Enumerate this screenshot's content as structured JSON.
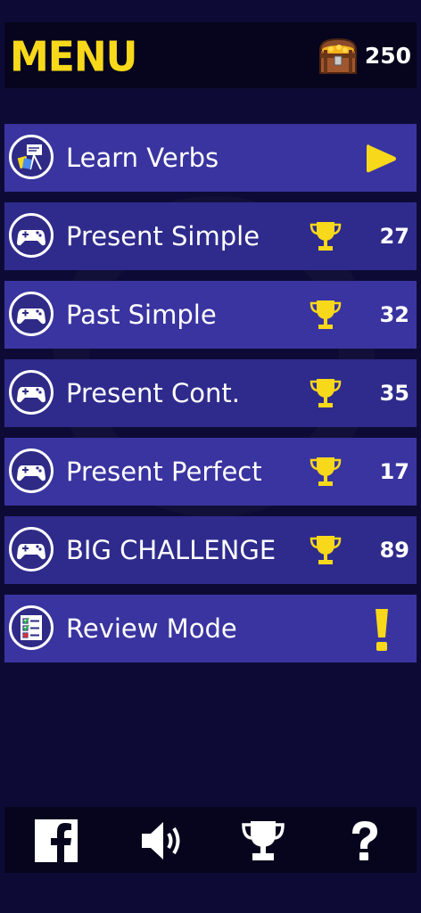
{
  "header": {
    "title": "MENU",
    "coins": "250",
    "coins_icon": "treasure-chest-icon"
  },
  "menu": {
    "items": [
      {
        "label": "Learn Verbs",
        "icon": "learn-verbs-icon",
        "action_icon": "play-icon"
      },
      {
        "label": "Present Simple",
        "icon": "gamepad-icon",
        "score": "27",
        "score_icon": "trophy-icon"
      },
      {
        "label": "Past Simple",
        "icon": "gamepad-icon",
        "score": "32",
        "score_icon": "trophy-icon"
      },
      {
        "label": "Present Cont.",
        "icon": "gamepad-icon",
        "score": "35",
        "score_icon": "trophy-icon"
      },
      {
        "label": "Present Perfect",
        "icon": "gamepad-icon",
        "score": "17",
        "score_icon": "trophy-icon"
      },
      {
        "label": "BIG CHALLENGE",
        "icon": "gamepad-icon",
        "score": "89",
        "score_icon": "trophy-icon"
      },
      {
        "label": "Review Mode",
        "icon": "checklist-icon",
        "action_icon": "exclamation-icon"
      }
    ]
  },
  "footer": {
    "buttons": [
      "facebook-icon",
      "sound-icon",
      "trophy-icon",
      "help-icon"
    ]
  },
  "colors": {
    "background": "#0d0b35",
    "bar": "#06051d",
    "item_light": "#3a34a0",
    "item_dark": "#2f2b8c",
    "accent_yellow": "#f7d81a"
  }
}
